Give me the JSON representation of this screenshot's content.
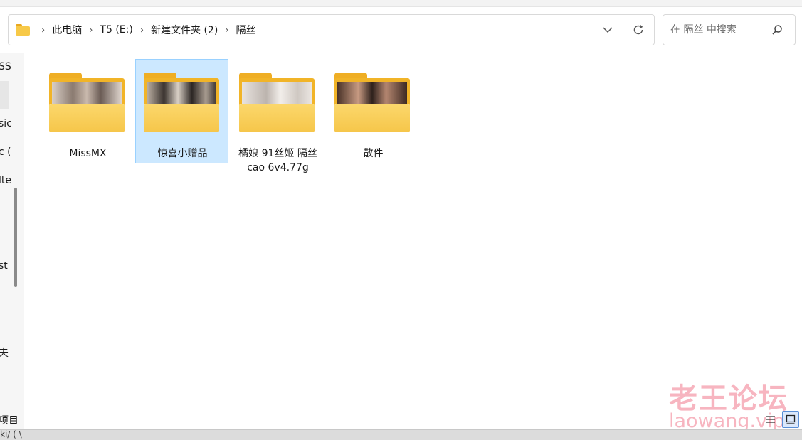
{
  "address": {
    "crumbs": [
      "此电脑",
      "T5 (E:)",
      "新建文件夹 (2)",
      "隔丝"
    ],
    "separator": "›"
  },
  "search": {
    "placeholder": "在 隔丝 中搜索"
  },
  "nav": {
    "items": [
      "SS",
      "sic",
      "c (",
      "lte",
      "st",
      "夫"
    ]
  },
  "folders": [
    {
      "name": "MissMX",
      "selected": false
    },
    {
      "name": "惊喜小赠品",
      "selected": true
    },
    {
      "name": "橘娘 91丝姬 隔丝\ncao 6v4.77g",
      "selected": false
    },
    {
      "name": "散件",
      "selected": false
    }
  ],
  "status": {
    "text": "项目"
  },
  "bottom": {
    "text": "ki/ ( \\"
  },
  "watermark": {
    "cn": "老王论坛",
    "en": "laowang.vip"
  },
  "colors": {
    "selection": "#cce8ff",
    "folder": "#f6c64a",
    "watermark": "#f0788c"
  }
}
